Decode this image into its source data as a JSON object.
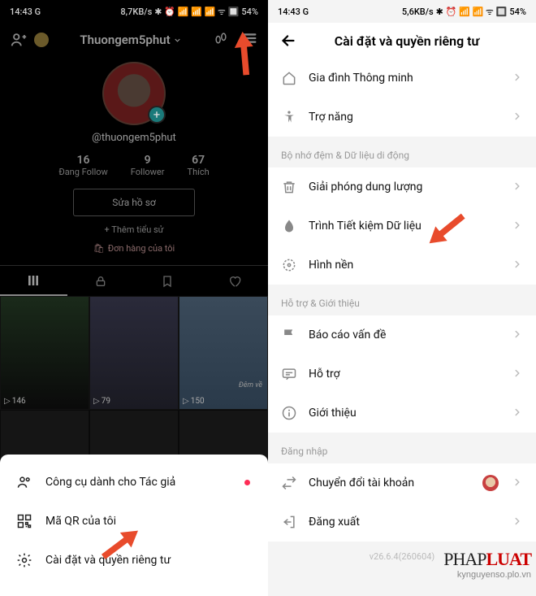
{
  "left": {
    "status": {
      "time": "14:43",
      "net": "8,7KB/s",
      "battery": "54%"
    },
    "profile": {
      "name": "Thuongem5phut",
      "username": "@thuongem5phut",
      "stats": [
        {
          "num": "16",
          "label": "Đang Follow"
        },
        {
          "num": "9",
          "label": "Follower"
        },
        {
          "num": "67",
          "label": "Thích"
        }
      ],
      "edit": "Sửa hồ sơ",
      "bio": "+ Thêm tiểu sử",
      "orders": "Đơn hàng của tôi"
    },
    "videos": [
      {
        "plays": "146"
      },
      {
        "plays": "79"
      },
      {
        "plays": "150",
        "caption": "Đêm về"
      }
    ],
    "sheet": [
      {
        "label": "Công cụ dành cho Tác giả",
        "dot": true
      },
      {
        "label": "Mã QR của tôi"
      },
      {
        "label": "Cài đặt và quyền riêng tư"
      }
    ]
  },
  "right": {
    "status": {
      "time": "14:43",
      "net": "5,6KB/s",
      "battery": "54%"
    },
    "title": "Cài đặt và quyền riêng tư",
    "group0": [
      {
        "icon": "smart-family",
        "label": "Gia đình Thông minh"
      },
      {
        "icon": "accessibility",
        "label": "Trợ năng"
      }
    ],
    "section1_label": "Bộ nhớ đệm & Dữ liệu di động",
    "group1": [
      {
        "icon": "trash",
        "label": "Giải phóng dung lượng"
      },
      {
        "icon": "data-saver",
        "label": "Trình Tiết kiệm Dữ liệu"
      },
      {
        "icon": "wallpaper",
        "label": "Hình nền"
      }
    ],
    "section2_label": "Hỗ trợ & Giới thiệu",
    "group2": [
      {
        "icon": "flag",
        "label": "Báo cáo vấn đề"
      },
      {
        "icon": "support",
        "label": "Hỗ trợ"
      },
      {
        "icon": "info",
        "label": "Giới thiệu"
      }
    ],
    "section3_label": "Đăng nhập",
    "group3": [
      {
        "icon": "switch",
        "label": "Chuyển đổi tài khoản",
        "avatar": true
      },
      {
        "icon": "logout",
        "label": "Đăng xuất"
      }
    ],
    "version": "v26.6.4(260604)"
  },
  "watermark": {
    "brand_black": "PHAP",
    "brand_red": "LUAT",
    "sub": "kynguyenso.plo.vn"
  }
}
